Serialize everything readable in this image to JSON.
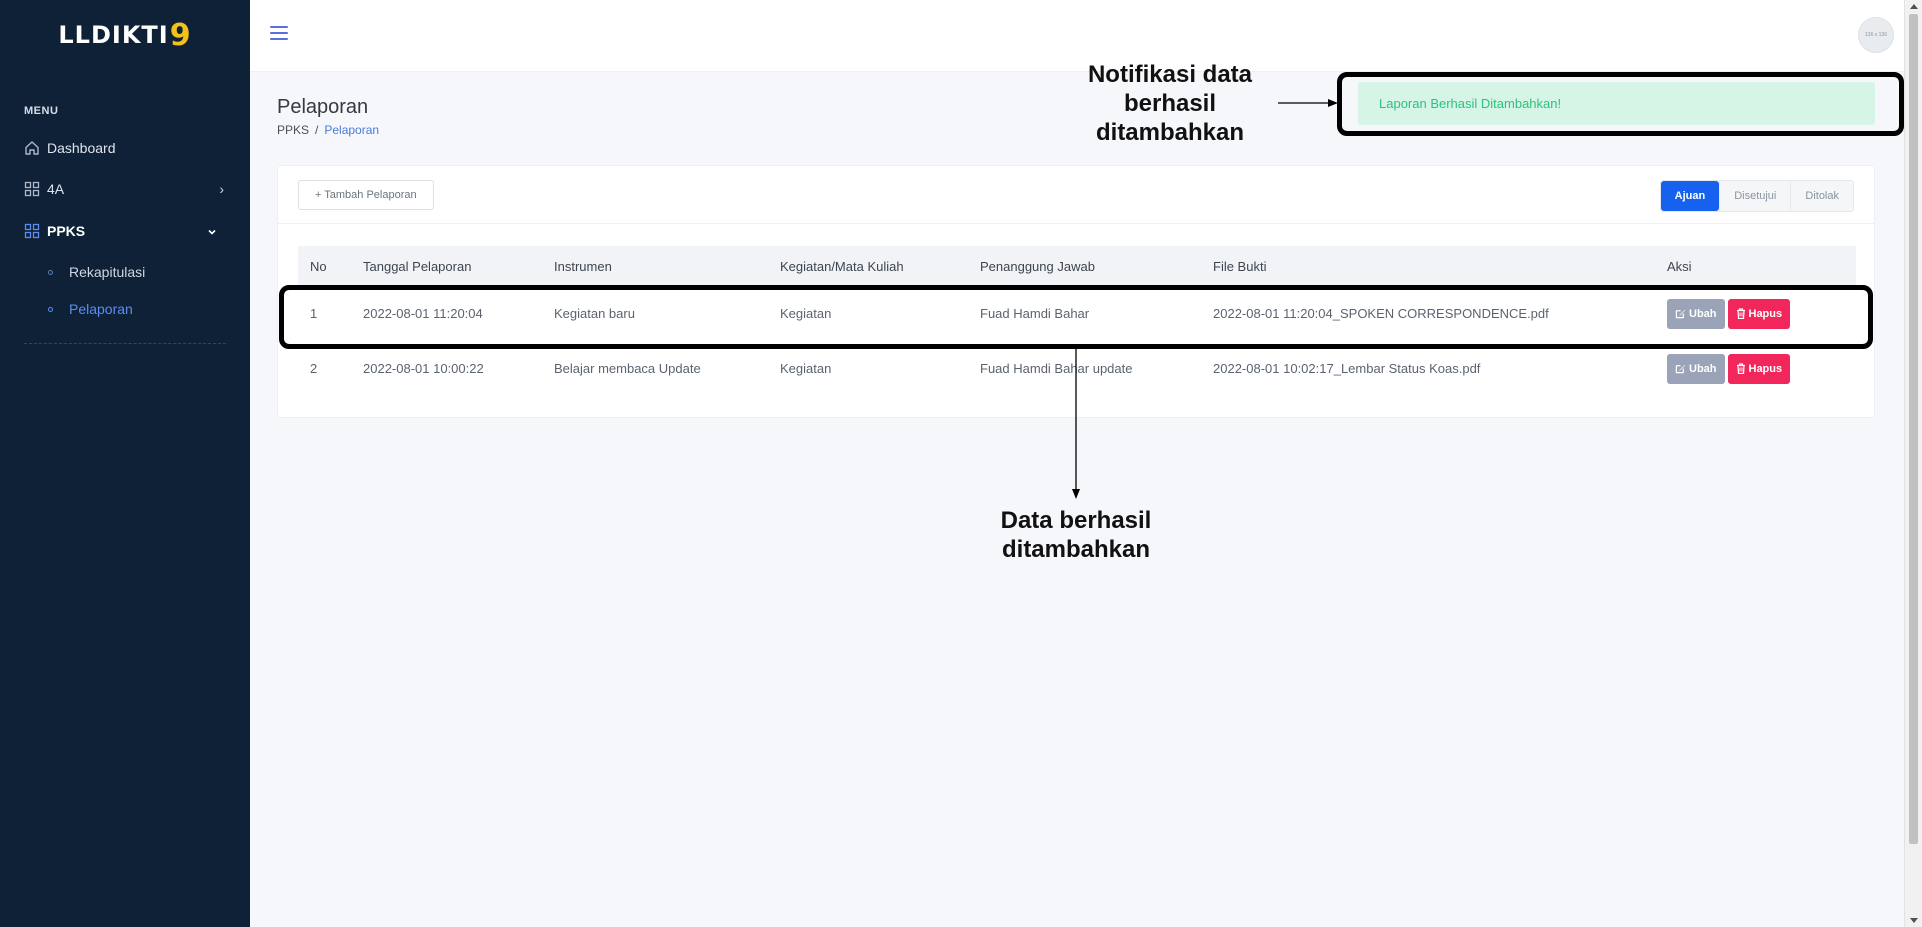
{
  "sidebar": {
    "logo_text": "LLDIKTI",
    "logo_accent": "9",
    "menu_title": "MENU",
    "items": [
      {
        "label": "Dashboard"
      },
      {
        "label": "4A"
      },
      {
        "label": "PPKS"
      }
    ],
    "sub_items": [
      {
        "label": "Rekapitulasi"
      },
      {
        "label": "Pelaporan"
      }
    ]
  },
  "topbar": {
    "avatar_text": "136 x 136"
  },
  "page": {
    "title": "Pelaporan",
    "breadcrumb_root": "PPKS",
    "breadcrumb_sep": "/",
    "breadcrumb_current": "Pelaporan"
  },
  "alert": {
    "message": "Laporan Berhasil Ditambahkan!"
  },
  "toolbar": {
    "add_label": "+ Tambah Pelaporan",
    "tabs": [
      "Ajuan",
      "Disetujui",
      "Ditolak"
    ]
  },
  "table": {
    "headers": [
      "No",
      "Tanggal Pelaporan",
      "Instrumen",
      "Kegiatan/Mata Kuliah",
      "Penanggung Jawab",
      "File Bukti",
      "Aksi"
    ],
    "rows": [
      {
        "no": "1",
        "tanggal": "2022-08-01 11:20:04",
        "instrumen": "Kegiatan baru",
        "kegiatan": "Kegiatan",
        "pj": "Fuad Hamdi Bahar",
        "file": "2022-08-01 11:20:04_SPOKEN CORRESPONDENCE.pdf"
      },
      {
        "no": "2",
        "tanggal": "2022-08-01 10:00:22",
        "instrumen": "Belajar membaca Update",
        "kegiatan": "Kegiatan",
        "pj": "Fuad Hamdi Bahar update",
        "file": "2022-08-01 10:02:17_Lembar Status Koas.pdf"
      }
    ],
    "edit_label": "Ubah",
    "delete_label": "Hapus"
  },
  "annotations": {
    "notif_line1": "Notifikasi data",
    "notif_line2": "berhasil",
    "notif_line3": "ditambahkan",
    "data_line1": "Data berhasil",
    "data_line2": "ditambahkan"
  },
  "colors": {
    "sidebar_bg": "#0f2137",
    "primary": "#1661ee",
    "danger": "#f1275c",
    "success_bg": "#d6f5e7",
    "success_text": "#2fc07e"
  }
}
